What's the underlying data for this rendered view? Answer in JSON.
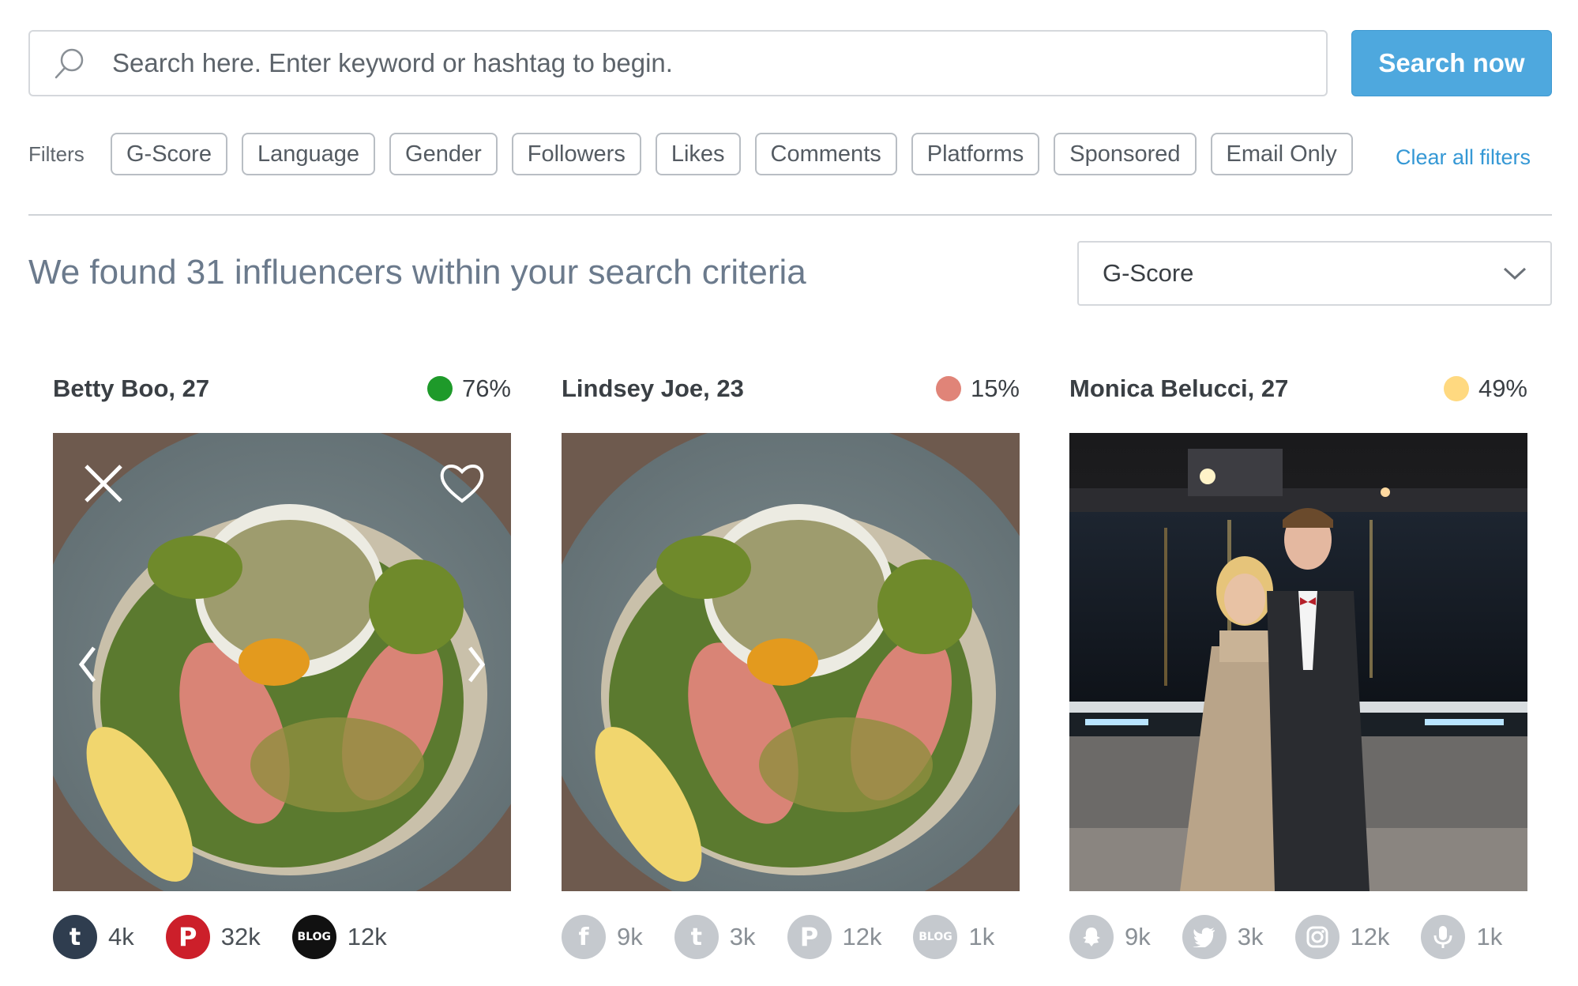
{
  "search": {
    "placeholder": "Search here. Enter keyword or hashtag to begin.",
    "button_label": "Search now"
  },
  "filters": {
    "label": "Filters",
    "chips": [
      "G-Score",
      "Language",
      "Gender",
      "Followers",
      "Likes",
      "Comments",
      "Platforms",
      "Sponsored",
      "Email Only"
    ],
    "clear_label": "Clear all filters"
  },
  "results": {
    "summary": "We found 31 influencers within your search criteria",
    "sort_value": "G-Score"
  },
  "cards": [
    {
      "name": "Betty Boo, 27",
      "score": "76%",
      "score_color": "#1e9a2a",
      "image": "food-salad",
      "socials": [
        {
          "icon": "tumblr-icon",
          "count": "4k",
          "color": "#2f3d4f"
        },
        {
          "icon": "pinterest-icon",
          "count": "32k",
          "color": "#cc1f2a"
        },
        {
          "icon": "blog-icon",
          "count": "12k",
          "color": "#111111"
        }
      ]
    },
    {
      "name": "Lindsey Joe, 23",
      "score": "15%",
      "score_color": "#e08478",
      "image": "food-salad",
      "socials": [
        {
          "icon": "facebook-icon",
          "count": "9k",
          "color": "#c5c9ce"
        },
        {
          "icon": "tumblr-icon",
          "count": "3k",
          "color": "#c5c9ce"
        },
        {
          "icon": "pinterest-icon",
          "count": "12k",
          "color": "#c5c9ce"
        },
        {
          "icon": "blog-icon",
          "count": "1k",
          "color": "#c5c9ce"
        }
      ]
    },
    {
      "name": "Monica Belucci, 27",
      "score": "49%",
      "score_color": "#ffd980",
      "image": "couple-night-harbor",
      "socials": [
        {
          "icon": "snapchat-icon",
          "count": "9k",
          "color": "#c5c9ce"
        },
        {
          "icon": "twitter-icon",
          "count": "3k",
          "color": "#c5c9ce"
        },
        {
          "icon": "instagram-icon",
          "count": "12k",
          "color": "#c5c9ce"
        },
        {
          "icon": "microphone-icon",
          "count": "1k",
          "color": "#c5c9ce"
        }
      ]
    }
  ]
}
